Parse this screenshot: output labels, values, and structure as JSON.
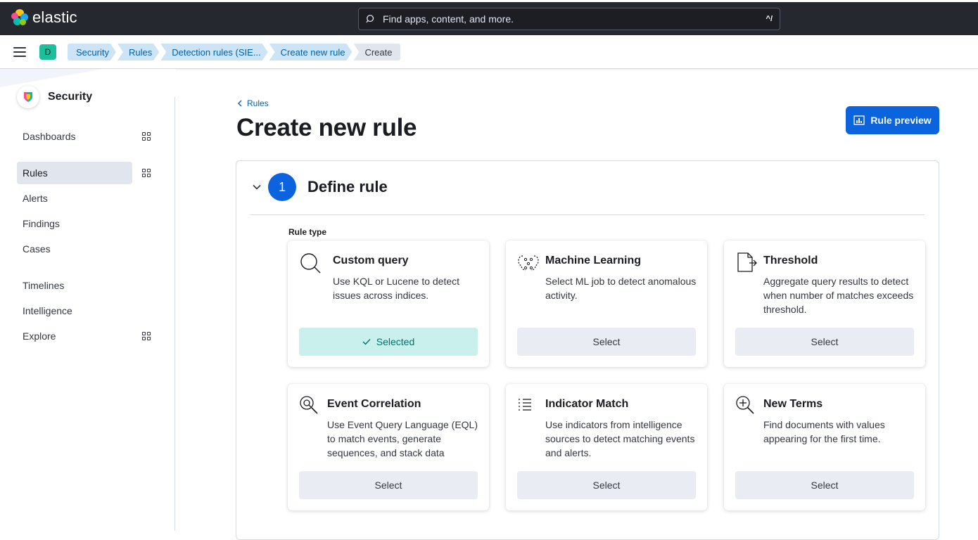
{
  "header": {
    "brand": "elastic",
    "search_placeholder": "Find apps, content, and more.",
    "search_shortcut": "^/"
  },
  "subheader": {
    "space_initial": "D",
    "breadcrumbs": [
      "Security",
      "Rules",
      "Detection rules (SIE...",
      "Create new rule",
      "Create"
    ]
  },
  "sidenav": {
    "title": "Security",
    "items": [
      {
        "label": "Dashboards"
      },
      {
        "label": "Rules"
      },
      {
        "label": "Alerts"
      },
      {
        "label": "Findings"
      },
      {
        "label": "Cases"
      },
      {
        "label": "Timelines"
      },
      {
        "label": "Intelligence"
      },
      {
        "label": "Explore"
      }
    ]
  },
  "main": {
    "back_label": "Rules",
    "title": "Create new rule",
    "preview_button": "Rule preview",
    "step": {
      "number": "1",
      "title": "Define rule",
      "rule_type_label": "Rule type"
    },
    "cards": [
      {
        "title": "Custom query",
        "description": "Use KQL or Lucene to detect issues across indices.",
        "button": "Selected",
        "icon": "search-icon"
      },
      {
        "title": "Machine Learning",
        "description": "Select ML job to detect anomalous activity.",
        "button": "Select",
        "icon": "machine-learning-icon"
      },
      {
        "title": "Threshold",
        "description": "Aggregate query results to detect when number of matches exceeds threshold.",
        "button": "Select",
        "icon": "threshold-icon"
      },
      {
        "title": "Event Correlation",
        "description": "Use Event Query Language (EQL) to match events, generate sequences, and stack data",
        "button": "Select",
        "icon": "eql-icon"
      },
      {
        "title": "Indicator Match",
        "description": "Use indicators from intelligence sources to detect matching events and alerts.",
        "button": "Select",
        "icon": "list-icon"
      },
      {
        "title": "New Terms",
        "description": "Find documents with values appearing for the first time.",
        "button": "Select",
        "icon": "magnify-plus-icon"
      }
    ]
  }
}
